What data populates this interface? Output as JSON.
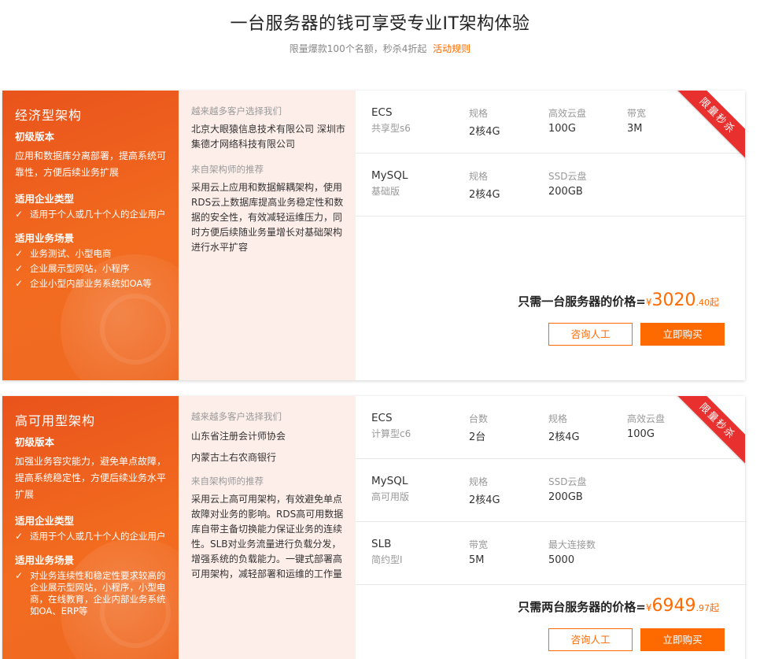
{
  "hero": {
    "title": "一台服务器的钱可享受专业IT架构体验",
    "subtitle": "限量爆款100个名额，秒杀4折起",
    "rule_link": "活动规则"
  },
  "colors": {
    "accent": "#ff6a00",
    "ribbon": "#e8312f",
    "left_panel": "#ee5e1e",
    "mid_panel": "#fdeee9"
  },
  "cards": [
    {
      "ribbon": "限量秒杀",
      "left": {
        "title": "经济型架构",
        "version": "初级版本",
        "desc": "应用和数据库分离部署，提高系统可靠性，方便后续业务扩展",
        "enterprise_heading": "适用企业类型",
        "enterprise_items": [
          "适用于个人或几十个人的企业用户"
        ],
        "scenario_heading": "适用业务场景",
        "scenario_items": [
          "业务测试、小型电商",
          "企业展示型网站，小程序",
          "企业小型内部业务系统如OA等"
        ]
      },
      "mid": {
        "customers_label": "越来越多客户选择我们",
        "customers": [
          "北京大眼猿信息技术有限公司 深圳市集德才网络科技有限公司"
        ],
        "recommend_label": "来自架构师的推荐",
        "recommend_text": "采用云上应用和数据解耦架构，使用RDS云上数据库提高业务稳定性和数据的安全性，有效减轻运维压力，同时方便后续随业务量增长对基础架构进行水平扩容"
      },
      "specs": [
        {
          "name": "ECS",
          "sub": "共享型s6",
          "cols": [
            {
              "label": "规格",
              "value": "2核4G"
            },
            {
              "label": "高效云盘",
              "value": "100G"
            },
            {
              "label": "带宽",
              "value": "3M"
            }
          ]
        },
        {
          "name": "MySQL",
          "sub": "基础版",
          "cols": [
            {
              "label": "规格",
              "value": "2核4G"
            },
            {
              "label": "SSD云盘",
              "value": "200GB"
            }
          ]
        }
      ],
      "price": {
        "prefix": "只需一台服务器的价格=",
        "yen": "¥",
        "integer": "3020",
        "decimal": ".40",
        "suffix": "起"
      },
      "buttons": {
        "consult": "咨询人工",
        "buy": "立即购买"
      }
    },
    {
      "ribbon": "限量秒杀",
      "left": {
        "title": "高可用型架构",
        "version": "初级版本",
        "desc": "加强业务容灾能力，避免单点故障，提高系统稳定性，方便后续业务水平扩展",
        "enterprise_heading": "适用企业类型",
        "enterprise_items": [
          "适用于个人或几十个人的企业用户"
        ],
        "scenario_heading": "适用业务场景",
        "scenario_items": [
          "对业务连续性和稳定性要求较高的企业展示型网站，小程序，小型电商，在线教育，企业内部业务系统如OA、ERP等"
        ]
      },
      "mid": {
        "customers_label": "越来越多客户选择我们",
        "customers": [
          "山东省注册会计师协会",
          "内蒙古土右农商银行"
        ],
        "recommend_label": "来自架构师的推荐",
        "recommend_text": "采用云上高可用架构，有效避免单点故障对业务的影响。RDS高可用数据库自带主备切换能力保证业务的连续性。SLB对业务流量进行负载分发，增强系统的负载能力。一键式部署高可用架构，减轻部署和运维的工作量"
      },
      "specs": [
        {
          "name": "ECS",
          "sub": "计算型c6",
          "cols": [
            {
              "label": "台数",
              "value": "2台"
            },
            {
              "label": "规格",
              "value": "2核4G"
            },
            {
              "label": "高效云盘",
              "value": "100G"
            }
          ]
        },
        {
          "name": "MySQL",
          "sub": "高可用版",
          "cols": [
            {
              "label": "规格",
              "value": "2核4G"
            },
            {
              "label": "SSD云盘",
              "value": "200GB"
            }
          ]
        },
        {
          "name": "SLB",
          "sub": "简约型I",
          "cols": [
            {
              "label": "带宽",
              "value": "5M"
            },
            {
              "label": "最大连接数",
              "value": "5000"
            }
          ]
        }
      ],
      "price": {
        "prefix": "只需两台服务器的价格=",
        "yen": "¥",
        "integer": "6949",
        "decimal": ".97",
        "suffix": "起"
      },
      "buttons": {
        "consult": "咨询人工",
        "buy": "立即购买"
      }
    }
  ]
}
